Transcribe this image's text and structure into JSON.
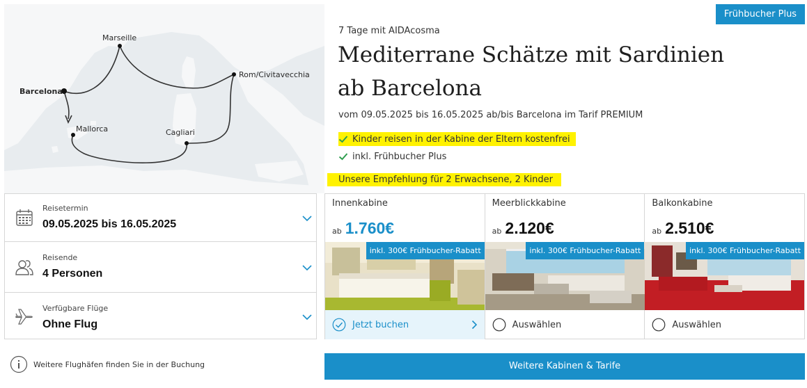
{
  "badge": "Frühbucher Plus",
  "ship_line": "7 Tage mit AIDAcosma",
  "title": "Mediterrane Schätze mit Sardinien ab Barcelona",
  "dates_line": "vom 09.05.2025 bis 16.05.2025 ab/bis Barcelona im Tarif PREMIUM",
  "features": [
    {
      "label": "Kinder reisen in der Kabine der Eltern kostenfrei",
      "icon": "check-icon"
    },
    {
      "label": "inkl. Frühbucher Plus",
      "icon": "check-icon"
    }
  ],
  "recommendation": "Unsere Empfehlung für 2 Erwachsene, 2 Kinder",
  "map": {
    "ports": [
      {
        "name": "Marseille"
      },
      {
        "name": "Rom/Civitavecchia"
      },
      {
        "name": "Barcelona"
      },
      {
        "name": "Mallorca"
      },
      {
        "name": "Cagliari"
      }
    ]
  },
  "form": {
    "travel_date": {
      "label": "Reisetermin",
      "value": "09.05.2025 bis 16.05.2025",
      "icon": "calendar-icon"
    },
    "travelers": {
      "label": "Reisende",
      "value": "4 Personen",
      "icon": "people-icon"
    },
    "flights": {
      "label": "Verfügbare Flüge",
      "value": "Ohne Flug",
      "icon": "airplane-icon"
    }
  },
  "note": "Weitere Flughäfen finden Sie in der Buchung",
  "cabins": [
    {
      "name": "Innenkabine",
      "price_prefix": "ab",
      "price": "1.760€",
      "discount": "inkl. 300€ Frühbucher-Rabatt",
      "action": "Jetzt buchen",
      "selected": true
    },
    {
      "name": "Meerblickkabine",
      "price_prefix": "ab",
      "price": "2.120€",
      "discount": "inkl. 300€ Frühbucher-Rabatt",
      "action": "Auswählen",
      "selected": false
    },
    {
      "name": "Balkonkabine",
      "price_prefix": "ab",
      "price": "2.510€",
      "discount": "inkl. 300€ Frühbucher-Rabatt",
      "action": "Auswählen",
      "selected": false
    }
  ],
  "more_button": "Weitere Kabinen & Tarife",
  "colors": {
    "accent": "#1a8fc9",
    "highlight": "#fff200",
    "check": "#2e9e4f"
  }
}
